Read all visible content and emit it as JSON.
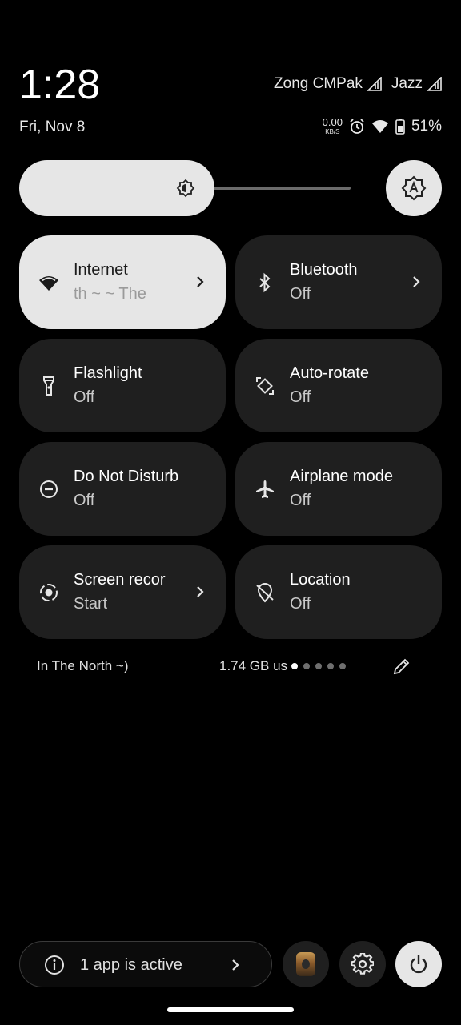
{
  "status": {
    "time": "1:28",
    "date": "Fri, Nov 8",
    "carrier1": "Zong CMPak",
    "carrier2": "Jazz",
    "net_speed_value": "0.00",
    "net_speed_unit": "KB/S",
    "battery": "51%"
  },
  "brightness": {
    "level_percent": 59
  },
  "tiles": [
    {
      "title": "Internet",
      "subtitle": "th ~          ~ The",
      "active": true,
      "icon": "wifi-icon",
      "chevron": true
    },
    {
      "title": "Bluetooth",
      "subtitle": "Off",
      "active": false,
      "icon": "bluetooth-icon",
      "chevron": true
    },
    {
      "title": "Flashlight",
      "subtitle": "Off",
      "active": false,
      "icon": "flashlight-icon",
      "chevron": false
    },
    {
      "title": "Auto-rotate",
      "subtitle": "Off",
      "active": false,
      "icon": "auto-rotate-icon",
      "chevron": false
    },
    {
      "title": "Do Not Disturb",
      "subtitle": "Off",
      "active": false,
      "icon": "do-not-disturb-icon",
      "chevron": false
    },
    {
      "title": "Airplane mode",
      "subtitle": "Off",
      "active": false,
      "icon": "airplane-icon",
      "chevron": false
    },
    {
      "title": "Screen recor",
      "subtitle": "Start",
      "active": false,
      "icon": "screen-record-icon",
      "chevron": true
    },
    {
      "title": "Location",
      "subtitle": "Off",
      "active": false,
      "icon": "location-off-icon",
      "chevron": false
    }
  ],
  "footer": {
    "network_name": "In The North ~)",
    "data_usage": "1.74 GB us",
    "page_count": 5,
    "current_page": 1
  },
  "bottom_bar": {
    "active_apps": "1 app is active"
  }
}
